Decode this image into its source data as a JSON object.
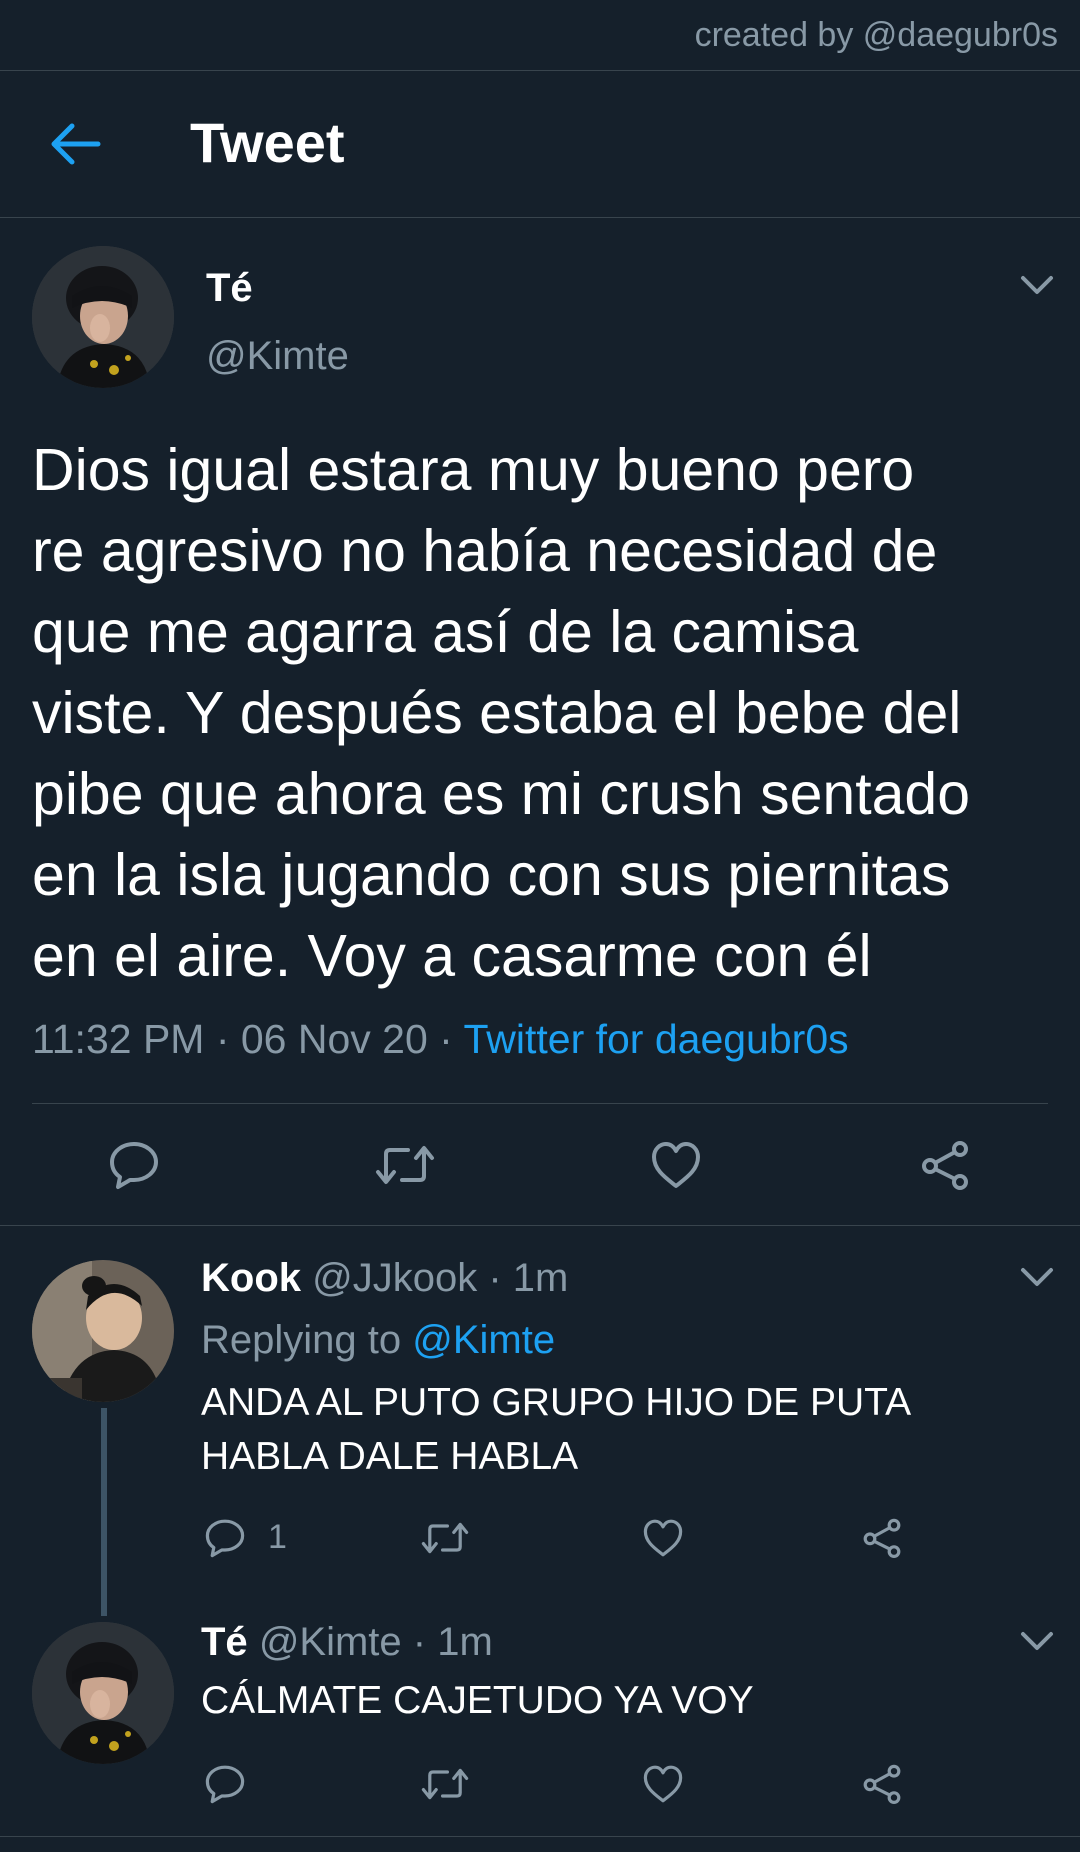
{
  "credit": "created by @daegubr0s",
  "header": {
    "title": "Tweet"
  },
  "tweet": {
    "name": "Té",
    "handle": "@Kimte",
    "text": "Dios igual estara muy bueno pero\nre agresivo no había necesidad de\nque me agarra así de la camisa\nviste. Y después estaba el bebe del\npibe que ahora es mi crush sentado\nen la isla jugando con sus piernitas\nen el aire. Voy a casarme con él",
    "time": "11:32 PM · 06 Nov 20 · ",
    "source": "Twitter for daegubr0s"
  },
  "replies": [
    {
      "name": "Kook",
      "handle": "@JJkook",
      "age": "· 1m",
      "replying_prefix": "Replying to ",
      "replying_to": "@Kimte",
      "text": "ANDA AL PUTO GRUPO HIJO DE PUTA\nHABLA DALE HABLA",
      "reply_count": "1"
    },
    {
      "name": "Té",
      "handle": "@Kimte",
      "age": "· 1m",
      "text": "CÁLMATE CAJETUDO YA VOY"
    }
  ],
  "colors": {
    "background": "#15202b",
    "accent": "#1da1f2",
    "muted": "#8899a6",
    "divider": "#38444d"
  },
  "icons": [
    "back-arrow-icon",
    "chevron-down-icon",
    "reply-icon",
    "retweet-icon",
    "like-icon",
    "share-icon"
  ]
}
